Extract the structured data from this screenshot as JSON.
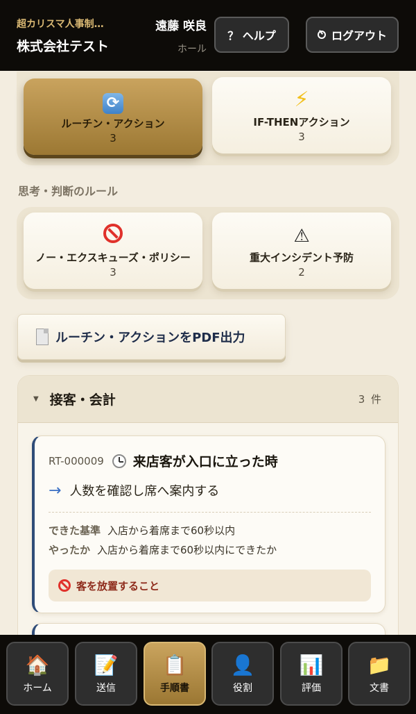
{
  "header": {
    "company_sub": "超カリスマ人事制…",
    "company_name": "株式会社テスト",
    "user_name": "遠藤 咲良",
    "user_role": "ホール",
    "help_label": "？ ヘルプ",
    "logout_label": "ログアウト"
  },
  "top_cards": [
    {
      "label": "ルーチン・アクション",
      "count": "3",
      "icon": "refresh-icon",
      "active": true
    },
    {
      "label": "IF-THENアクション",
      "count": "3",
      "icon": "zap-icon",
      "active": false
    }
  ],
  "rules_section_label": "思考・判断のルール",
  "rule_cards": [
    {
      "label": "ノー・エクスキューズ・ポリシー",
      "count": "3",
      "icon": "prohibit-icon"
    },
    {
      "label": "重大インシデント予防",
      "count": "2",
      "icon": "warning-icon"
    }
  ],
  "pdf_button_label": "ルーチン・アクションをPDF出力",
  "category": {
    "title": "接客・会計",
    "count": "3 件",
    "items": [
      {
        "id": "RT-000009",
        "title": "来店客が入口に立った時",
        "action": "人数を確認し席へ案内する",
        "criteria_label": "できた基準",
        "criteria_value": "入店から着席まで60秒以内",
        "check_label": "やったか",
        "check_value": "入店から着席まで60秒以内にできたか",
        "ng": "客を放置すること"
      }
    ]
  },
  "bottom_nav": [
    {
      "label": "ホーム",
      "icon": "house-icon"
    },
    {
      "label": "送信",
      "icon": "memo-icon"
    },
    {
      "label": "手順書",
      "icon": "clipboard-icon",
      "active": true
    },
    {
      "label": "役割",
      "icon": "person-icon"
    },
    {
      "label": "評価",
      "icon": "chart-icon"
    },
    {
      "label": "文書",
      "icon": "folder-icon"
    }
  ]
}
